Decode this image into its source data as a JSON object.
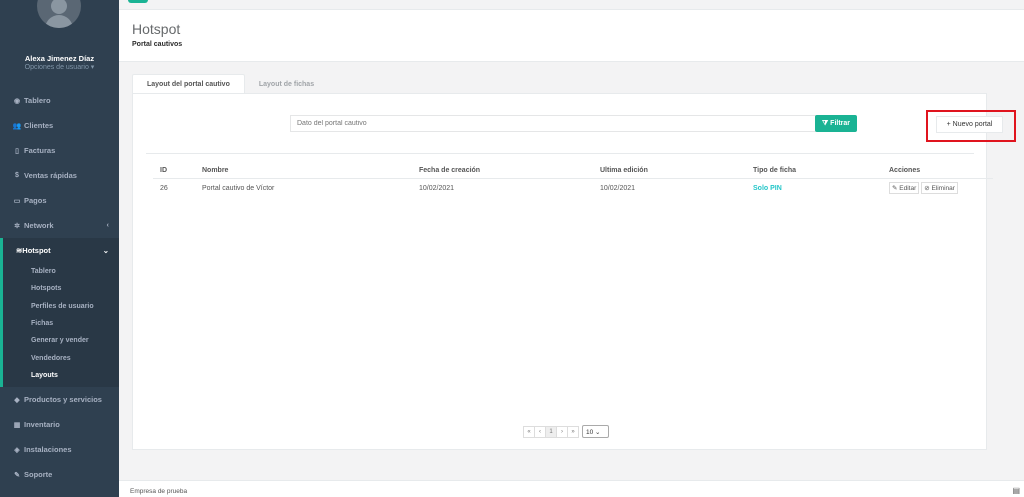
{
  "user": {
    "name": "Alexa Jimenez Díaz",
    "options": "Opciones de usuario ▾"
  },
  "nav": {
    "top": [
      {
        "label": "Tablero",
        "icon": "dashboard-icon",
        "glyph": "◉"
      },
      {
        "label": "Clientes",
        "icon": "users-icon",
        "glyph": "👥"
      },
      {
        "label": "Facturas",
        "icon": "file-icon",
        "glyph": "▯"
      },
      {
        "label": "Ventas rápidas",
        "icon": "dollar-icon",
        "glyph": "$"
      },
      {
        "label": "Pagos",
        "icon": "money-icon",
        "glyph": "▭"
      },
      {
        "label": "Network",
        "icon": "network-icon",
        "glyph": "✲"
      }
    ],
    "hotspot": {
      "label": "Hotspot",
      "icon": "wifi-icon",
      "glyph": "≋",
      "subs": [
        "Tablero",
        "Hotspots",
        "Perfiles de usuario",
        "Fichas",
        "Generar y vender",
        "Vendedores",
        "Layouts"
      ]
    },
    "bottom": [
      {
        "label": "Productos y servicios",
        "icon": "tag-icon",
        "glyph": "◆"
      },
      {
        "label": "Inventario",
        "icon": "boxes-icon",
        "glyph": "▦"
      },
      {
        "label": "Instalaciones",
        "icon": "wrench-icon",
        "glyph": "◈"
      },
      {
        "label": "Soporte",
        "icon": "tools-icon",
        "glyph": "✎"
      }
    ]
  },
  "page": {
    "title": "Hotspot",
    "subtitle": "Portal cautivos"
  },
  "tabs": [
    "Layout del portal cautivo",
    "Layout de fichas"
  ],
  "search": {
    "placeholder": "Dato del portal cautivo",
    "filter": "⧩ Filtrar"
  },
  "new_button": "+ Nuevo portal",
  "table": {
    "headers": [
      "ID",
      "Nombre",
      "Fecha de creación",
      "Ultima edición",
      "Tipo de ficha",
      "Acciones"
    ],
    "rows": [
      {
        "id": "26",
        "nombre": "Portal cautivo de Víctor",
        "creacion": "10/02/2021",
        "edicion": "10/02/2021",
        "tipo": "Solo PIN",
        "edit": "✎ Editar",
        "delete": "⊘ Eliminar"
      }
    ]
  },
  "pagination": {
    "first": "«",
    "prev": "‹",
    "page": "1",
    "next": "›",
    "last": "»",
    "per_page": "10 ⌄"
  },
  "footer": {
    "company": "Empresa de prueba"
  },
  "colors": {
    "accent": "#1ab394",
    "sidebar": "#2f4050",
    "highlight": "#e0141e"
  }
}
